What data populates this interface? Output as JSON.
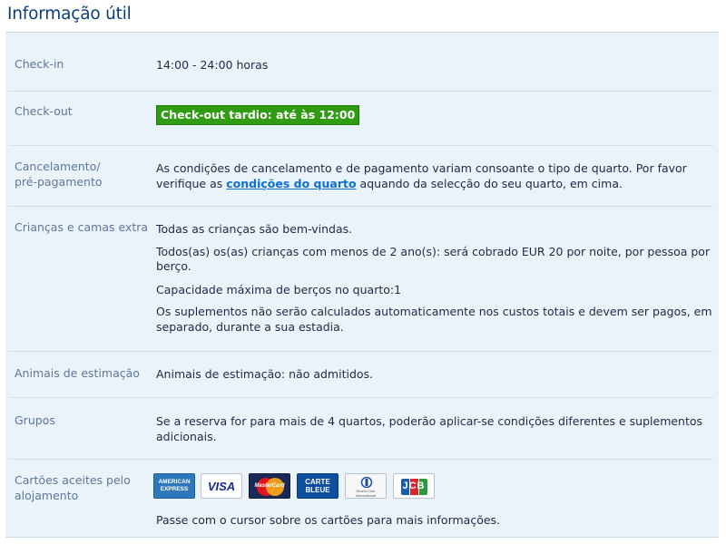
{
  "page": {
    "title": "Informação útil"
  },
  "checkin": {
    "label": "Check-in",
    "value": "14:00 - 24:00 horas"
  },
  "checkout": {
    "label": "Check-out",
    "badge": "Check-out tardio: até às 12:00",
    "badge_color": "#2f9c14"
  },
  "cancellation": {
    "label_line1": "Cancelamento/",
    "label_line2": "pré-pagamento",
    "text_before": "As condições de cancelamento e de pagamento variam consoante o tipo de quarto. Por favor verifique as",
    "link": "condições do quarto",
    "text_after": "aquando da selecção do seu quarto, em cima."
  },
  "children": {
    "label": "Crianças e camas extra",
    "p1": "Todas as crianças são bem-vindas.",
    "p2": "Todos(as) os(as) crianças com menos de 2 ano(s): será cobrado EUR 20 por noite, por pessoa por berço.",
    "p3": "Capacidade máxima de berços no quarto:1",
    "p4": "Os suplementos não serão calculados automaticamente nos custos totais e devem ser pagos, em separado, durante a sua estadia."
  },
  "pets": {
    "label": "Animais de estimação",
    "value": "Animais de estimação: não admitidos."
  },
  "groups": {
    "label": "Grupos",
    "value": "Se a reserva for para mais de 4 quartos, poderão aplicar-se condições diferentes e suplementos adicionais."
  },
  "cards": {
    "label_line1": "Cartões aceites pelo",
    "label_line2": "alojamento",
    "items": [
      {
        "name": "American Express",
        "icon": "amex-card-icon",
        "line1": "AMERICAN",
        "line2": "EXPRESS",
        "bg": "#2e77bb"
      },
      {
        "name": "VISA",
        "icon": "visa-card-icon",
        "line1": "VISA",
        "bg": "#ffffff"
      },
      {
        "name": "MasterCard",
        "icon": "mastercard-card-icon",
        "line1": "MasterCard",
        "bg": "#1a2a56"
      },
      {
        "name": "Carte Bleue",
        "icon": "carte-bleue-card-icon",
        "line1": "CARTE",
        "line2": "BLEUE",
        "bg": "#0d4f9e"
      },
      {
        "name": "Diners Club",
        "icon": "diners-club-card-icon",
        "line1": "Diners Club",
        "line2": "International",
        "bg": "#f7f7f7"
      },
      {
        "name": "JCB",
        "icon": "jcb-card-icon",
        "line1": "JCB",
        "bg": "#ffffff"
      }
    ],
    "hint": "Passe com o cursor sobre os cartões para mais informações."
  }
}
